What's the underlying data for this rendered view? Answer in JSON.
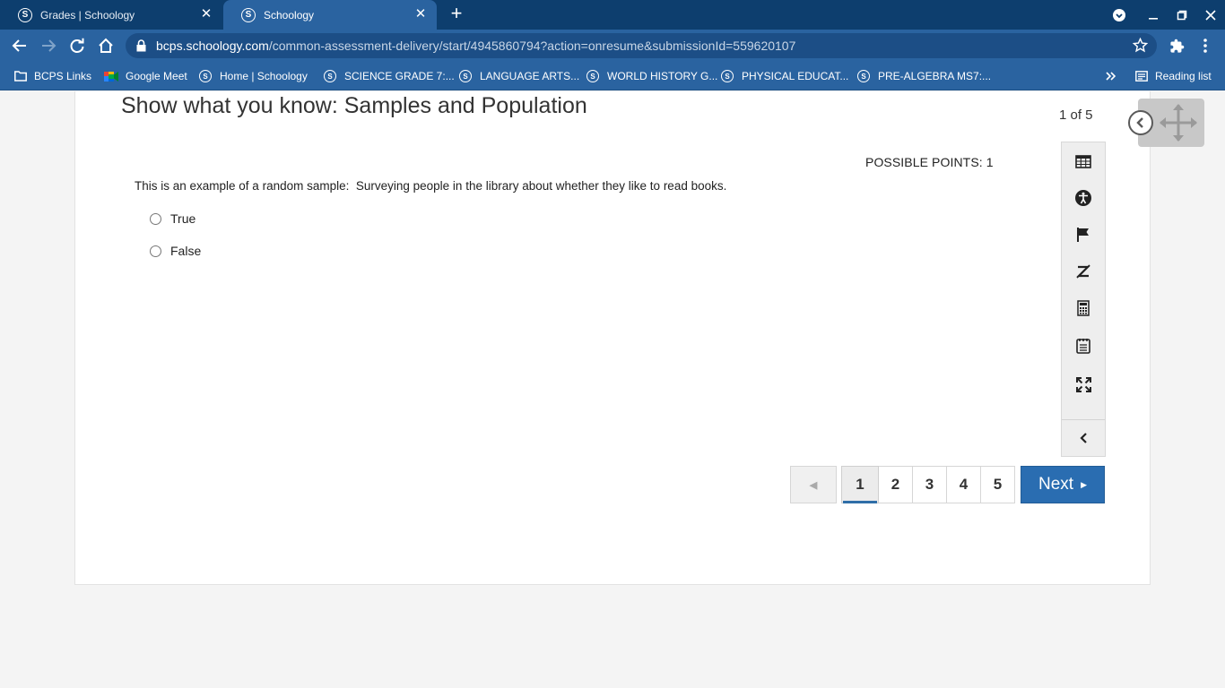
{
  "browser": {
    "tabs": [
      {
        "title": "Grades | Schoology",
        "active": false
      },
      {
        "title": "Schoology",
        "active": true
      }
    ],
    "url_host": "bcps.schoology.com",
    "url_path": "/common-assessment-delivery/start/4945860794?action=onresume&submissionId=559620107",
    "bookmarks": [
      {
        "label": "BCPS Links",
        "icon": "folder-icon"
      },
      {
        "label": "Google Meet",
        "icon": "google-meet-icon"
      },
      {
        "label": "Home | Schoology",
        "icon": "schoology-icon"
      },
      {
        "label": "SCIENCE GRADE 7:...",
        "icon": "schoology-icon"
      },
      {
        "label": "LANGUAGE ARTS...",
        "icon": "schoology-icon"
      },
      {
        "label": "WORLD HISTORY G...",
        "icon": "schoology-icon"
      },
      {
        "label": "PHYSICAL EDUCAT...",
        "icon": "schoology-icon"
      },
      {
        "label": "PRE-ALGEBRA MS7:...",
        "icon": "schoology-icon"
      }
    ],
    "reading_list": "Reading list"
  },
  "assessment": {
    "title": "Show what you know: Samples and Population",
    "counter": "1 of 5",
    "possible_points": "POSSIBLE POINTS: 1",
    "question": "This is an example of a random sample:  Surveying people in the library about whether they like to read books.",
    "choices": [
      "True",
      "False"
    ]
  },
  "tools": [
    "calendar-table-icon",
    "accessibility-icon",
    "flag-icon",
    "eliminator-icon",
    "calculator-icon",
    "notepad-icon",
    "fullscreen-icon",
    "collapse-icon"
  ],
  "pager": {
    "pages": [
      "1",
      "2",
      "3",
      "4",
      "5"
    ],
    "current_page": "1",
    "next_label": "Next"
  },
  "colors": {
    "tabstrip": "#0d3e6e",
    "toolbar": "#2a63a0",
    "next_button": "#2a6db1"
  }
}
